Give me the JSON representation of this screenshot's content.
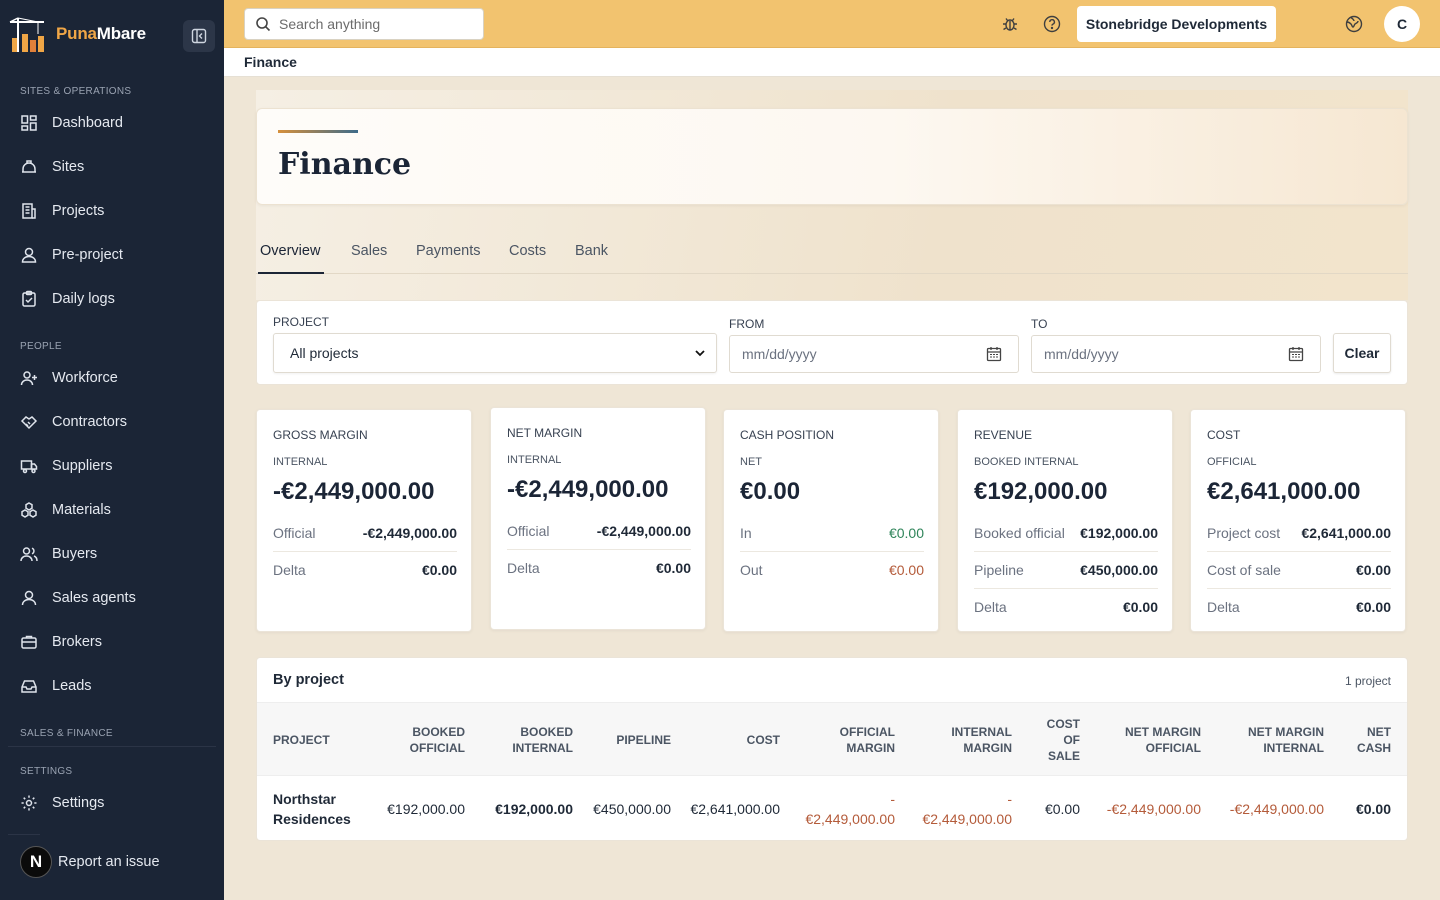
{
  "brand": {
    "name_part1": "Puna",
    "name_part2": "Mbare"
  },
  "sidebar": {
    "sections": {
      "sites": "SITES & OPERATIONS",
      "people": "PEOPLE",
      "sales": "SALES & FINANCE",
      "settings": "SETTINGS"
    },
    "items": [
      {
        "label": "Dashboard",
        "icon": "dashboard-icon"
      },
      {
        "label": "Sites",
        "icon": "sites-icon"
      },
      {
        "label": "Projects",
        "icon": "projects-icon"
      },
      {
        "label": "Pre-project",
        "icon": "pre-project-icon"
      },
      {
        "label": "Daily logs",
        "icon": "daily-logs-icon"
      },
      {
        "label": "Workforce",
        "icon": "workforce-icon"
      },
      {
        "label": "Contractors",
        "icon": "contractors-icon"
      },
      {
        "label": "Suppliers",
        "icon": "suppliers-icon"
      },
      {
        "label": "Materials",
        "icon": "materials-icon"
      },
      {
        "label": "Buyers",
        "icon": "buyers-icon"
      },
      {
        "label": "Sales agents",
        "icon": "sales-agents-icon"
      },
      {
        "label": "Brokers",
        "icon": "brokers-icon"
      },
      {
        "label": "Leads",
        "icon": "leads-icon"
      },
      {
        "label": "Settings",
        "icon": "settings-icon"
      }
    ],
    "report": {
      "badge": "N",
      "label": "Report an issue"
    }
  },
  "topbar": {
    "search_placeholder": "Search anything",
    "org": "Stonebridge Developments",
    "avatar": "C"
  },
  "breadcrumb": "Finance",
  "page": {
    "title": "Finance",
    "tabs": [
      "Overview",
      "Sales",
      "Payments",
      "Costs",
      "Bank"
    ],
    "active_tab": "Overview"
  },
  "filters": {
    "project_label": "PROJECT",
    "project_value": "All projects",
    "from_label": "FROM",
    "from_placeholder": "mm/dd/yyyy",
    "to_label": "TO",
    "to_placeholder": "mm/dd/yyyy",
    "clear": "Clear"
  },
  "cards": {
    "gross": {
      "title": "GROSS MARGIN",
      "sub": "INTERNAL",
      "value": "-€2,449,000.00",
      "r1l": "Official",
      "r1v": "-€2,449,000.00",
      "r2l": "Delta",
      "r2v": "€0.00"
    },
    "net": {
      "title": "NET MARGIN",
      "sub": "INTERNAL",
      "value": "-€2,449,000.00",
      "r1l": "Official",
      "r1v": "-€2,449,000.00",
      "r2l": "Delta",
      "r2v": "€0.00"
    },
    "cash": {
      "title": "CASH POSITION",
      "sub": "NET",
      "value": "€0.00",
      "r1l": "In",
      "r1v": "€0.00",
      "r2l": "Out",
      "r2v": "€0.00"
    },
    "revenue": {
      "title": "REVENUE",
      "sub": "BOOKED INTERNAL",
      "value": "€192,000.00",
      "r1l": "Booked official",
      "r1v": "€192,000.00",
      "r2l": "Pipeline",
      "r2v": "€450,000.00",
      "r3l": "Delta",
      "r3v": "€0.00"
    },
    "cost": {
      "title": "COST",
      "sub": "OFFICIAL",
      "value": "€2,641,000.00",
      "r1l": "Project cost",
      "r1v": "€2,641,000.00",
      "r2l": "Cost of sale",
      "r2v": "€0.00",
      "r3l": "Delta",
      "r3v": "€0.00"
    }
  },
  "by_project": {
    "title": "By project",
    "count": "1 project",
    "headers": {
      "project": "PROJECT",
      "booked_official": [
        "BOOKED",
        "OFFICIAL"
      ],
      "booked_internal": [
        "BOOKED",
        "INTERNAL"
      ],
      "pipeline": "PIPELINE",
      "cost": "COST",
      "official_margin": [
        "OFFICIAL",
        "MARGIN"
      ],
      "internal_margin": [
        "INTERNAL",
        "MARGIN"
      ],
      "cost_of_sale": [
        "COST",
        "OF",
        "SALE"
      ],
      "net_margin_official": [
        "NET MARGIN",
        "OFFICIAL"
      ],
      "net_margin_internal": [
        "NET MARGIN",
        "INTERNAL"
      ],
      "net_cash": [
        "NET",
        "CASH"
      ]
    },
    "rows": [
      {
        "project": [
          "Northstar",
          "Residences"
        ],
        "booked_official": "€192,000.00",
        "booked_internal": "€192,000.00",
        "pipeline": "€450,000.00",
        "cost": "€2,641,000.00",
        "official_margin": [
          "-",
          "€2,449,000.00"
        ],
        "internal_margin": [
          "-",
          "€2,449,000.00"
        ],
        "cost_of_sale": "€0.00",
        "net_margin_official": "-€2,449,000.00",
        "net_margin_internal": "-€2,449,000.00",
        "net_cash": "€0.00"
      }
    ]
  },
  "colors": {
    "sidebar": "#1b2536",
    "topbar": "#f2c36f",
    "positive": "#2f855a",
    "negative": "#b45b3a",
    "brand_accent": "#f0a646"
  }
}
